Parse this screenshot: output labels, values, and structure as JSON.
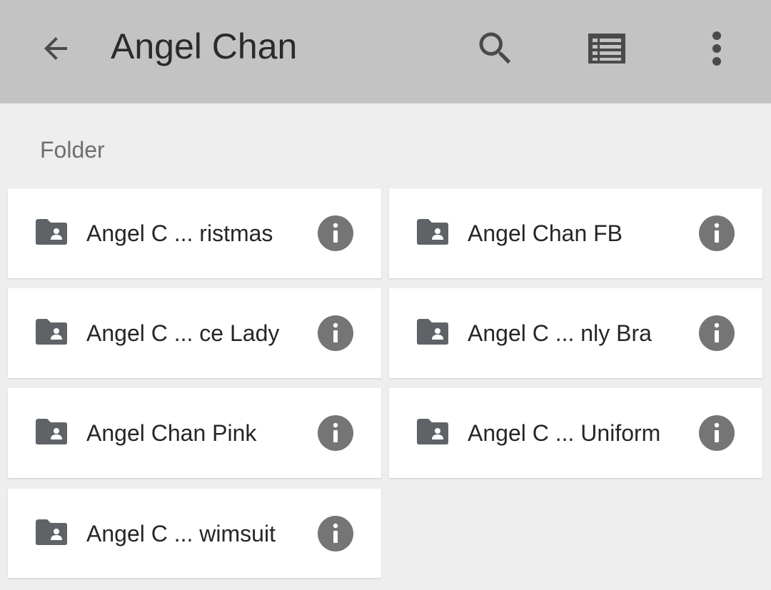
{
  "header": {
    "title": "Angel Chan",
    "back_icon": "arrow-back-icon",
    "search_icon": "search-icon",
    "view_icon": "list-view-icon",
    "more_icon": "more-vert-icon"
  },
  "section": {
    "label": "Folder"
  },
  "folders": [
    {
      "name": "Angel C ... ristmas"
    },
    {
      "name": "Angel Chan FB"
    },
    {
      "name": "Angel C ... ce Lady"
    },
    {
      "name": "Angel C ... nly Bra"
    },
    {
      "name": "Angel Chan Pink"
    },
    {
      "name": "Angel C ... Uniform"
    },
    {
      "name": "Angel C ... wimsuit"
    }
  ],
  "colors": {
    "appbar": "#c3c3c3",
    "background": "#eeeeee",
    "icon": "#5f6368",
    "info_icon": "#757575"
  }
}
